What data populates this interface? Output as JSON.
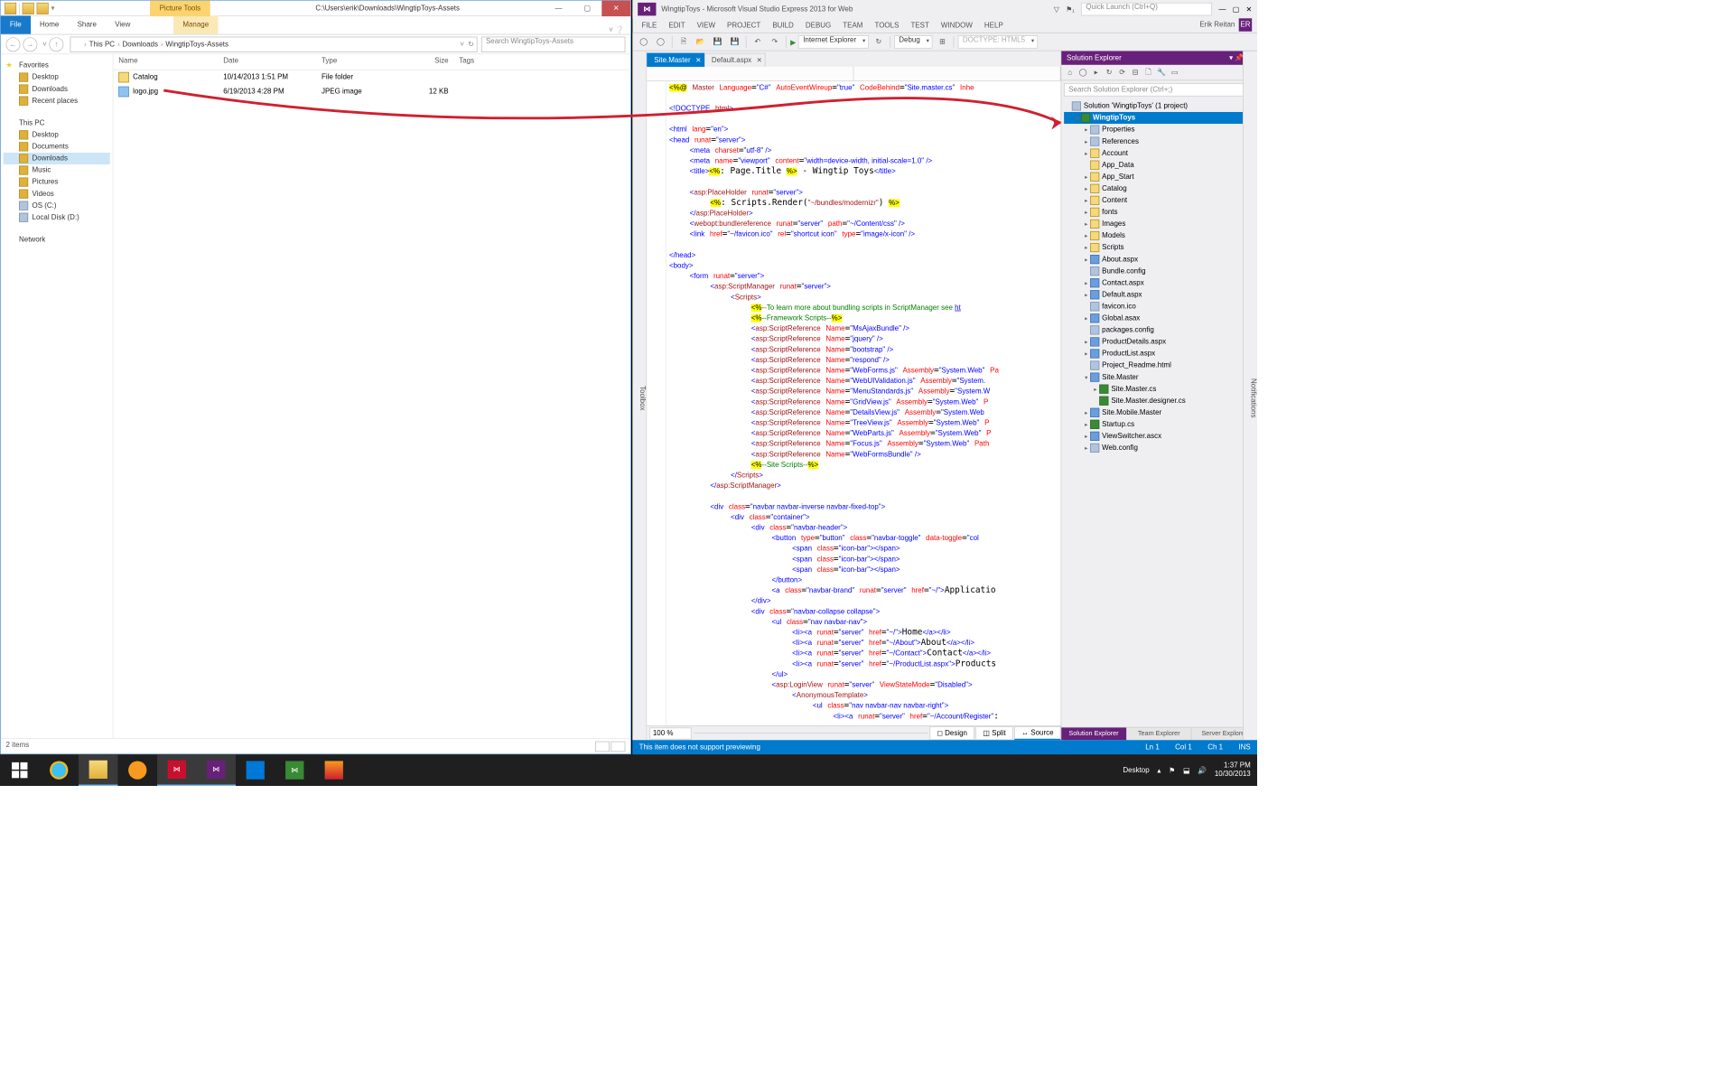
{
  "explorer": {
    "title": "C:\\Users\\erik\\Downloads\\WingtipToys-Assets",
    "context_tab": "Picture Tools",
    "ribbon": {
      "file": "File",
      "home": "Home",
      "share": "Share",
      "view": "View",
      "manage": "Manage"
    },
    "breadcrumbs": [
      "This PC",
      "Downloads",
      "WingtipToys-Assets"
    ],
    "search_placeholder": "Search WingtipToys-Assets",
    "columns": {
      "name": "Name",
      "date": "Date",
      "type": "Type",
      "size": "Size",
      "tags": "Tags"
    },
    "rows": [
      {
        "icon": "folder",
        "name": "Catalog",
        "date": "10/14/2013 1:51 PM",
        "type": "File folder",
        "size": "",
        "tags": ""
      },
      {
        "icon": "image",
        "name": "logo.jpg",
        "date": "6/19/2013 4:28 PM",
        "type": "JPEG image",
        "size": "12 KB",
        "tags": ""
      }
    ],
    "nav": {
      "favorites": {
        "label": "Favorites",
        "items": [
          "Desktop",
          "Downloads",
          "Recent places"
        ]
      },
      "thispc": {
        "label": "This PC",
        "items": [
          {
            "l": "Desktop"
          },
          {
            "l": "Documents"
          },
          {
            "l": "Downloads",
            "sel": true
          },
          {
            "l": "Music"
          },
          {
            "l": "Pictures"
          },
          {
            "l": "Videos"
          },
          {
            "l": "OS (C:)",
            "drv": true
          },
          {
            "l": "Local Disk (D:)",
            "drv": true
          }
        ]
      },
      "network": {
        "label": "Network"
      }
    },
    "status": "2 items"
  },
  "vs": {
    "title": "WingtipToys - Microsoft Visual Studio Express 2013 for Web",
    "user": "Erik Reitan",
    "user_initials": "ER",
    "quick_launch": "Quick Launch (Ctrl+Q)",
    "menus": [
      "FILE",
      "EDIT",
      "VIEW",
      "PROJECT",
      "BUILD",
      "DEBUG",
      "TEAM",
      "TOOLS",
      "TEST",
      "WINDOW",
      "HELP"
    ],
    "toolbar": {
      "browser": "Internet Explorer",
      "config": "Debug",
      "doctype": "DOCTYPE: HTML5"
    },
    "toolbox_label": "Toolbox",
    "notifications_label": "Notifications",
    "editor_tabs": [
      {
        "l": "Site.Master",
        "act": true
      },
      {
        "l": "Default.aspx"
      }
    ],
    "view_tabs": {
      "design": "Design",
      "split": "Split",
      "source": "Source"
    },
    "zoom": "100 %",
    "status": {
      "msg": "This item does not support previewing",
      "ln": "Ln 1",
      "col": "Col 1",
      "ch": "Ch 1",
      "ins": "INS"
    },
    "se": {
      "title": "Solution Explorer",
      "search": "Search Solution Explorer (Ctrl+;)",
      "sol": "Solution 'WingtipToys' (1 project)",
      "proj": "WingtipToys",
      "items": [
        {
          "l": "Properties",
          "i": "cfg",
          "tw": "▸",
          "ind": 2
        },
        {
          "l": "References",
          "i": "cfg",
          "tw": "▸",
          "ind": 2
        },
        {
          "l": "Account",
          "i": "fld",
          "tw": "▸",
          "ind": 2
        },
        {
          "l": "App_Data",
          "i": "fld",
          "tw": "",
          "ind": 2
        },
        {
          "l": "App_Start",
          "i": "fld",
          "tw": "▸",
          "ind": 2
        },
        {
          "l": "Catalog",
          "i": "fld",
          "tw": "▸",
          "ind": 2
        },
        {
          "l": "Content",
          "i": "fld",
          "tw": "▸",
          "ind": 2
        },
        {
          "l": "fonts",
          "i": "fld",
          "tw": "▸",
          "ind": 2
        },
        {
          "l": "Images",
          "i": "fld",
          "tw": "▸",
          "ind": 2
        },
        {
          "l": "Models",
          "i": "fld",
          "tw": "▸",
          "ind": 2
        },
        {
          "l": "Scripts",
          "i": "fld",
          "tw": "▸",
          "ind": 2
        },
        {
          "l": "About.aspx",
          "i": "asp",
          "tw": "▸",
          "ind": 2
        },
        {
          "l": "Bundle.config",
          "i": "cfg",
          "tw": "",
          "ind": 2
        },
        {
          "l": "Contact.aspx",
          "i": "asp",
          "tw": "▸",
          "ind": 2
        },
        {
          "l": "Default.aspx",
          "i": "asp",
          "tw": "▸",
          "ind": 2
        },
        {
          "l": "favicon.ico",
          "i": "cfg",
          "tw": "",
          "ind": 2
        },
        {
          "l": "Global.asax",
          "i": "asp",
          "tw": "▸",
          "ind": 2
        },
        {
          "l": "packages.config",
          "i": "cfg",
          "tw": "",
          "ind": 2
        },
        {
          "l": "ProductDetails.aspx",
          "i": "asp",
          "tw": "▸",
          "ind": 2
        },
        {
          "l": "ProductList.aspx",
          "i": "asp",
          "tw": "▸",
          "ind": 2
        },
        {
          "l": "Project_Readme.html",
          "i": "cfg",
          "tw": "",
          "ind": 2
        },
        {
          "l": "Site.Master",
          "i": "asp",
          "tw": "▾",
          "ind": 2
        },
        {
          "l": "Site.Master.cs",
          "i": "cs",
          "tw": "▸",
          "ind": 3
        },
        {
          "l": "Site.Master.designer.cs",
          "i": "cs",
          "tw": "",
          "ind": 3
        },
        {
          "l": "Site.Mobile.Master",
          "i": "asp",
          "tw": "▸",
          "ind": 2
        },
        {
          "l": "Startup.cs",
          "i": "cs",
          "tw": "▸",
          "ind": 2
        },
        {
          "l": "ViewSwitcher.ascx",
          "i": "asp",
          "tw": "▸",
          "ind": 2
        },
        {
          "l": "Web.config",
          "i": "cfg",
          "tw": "▸",
          "ind": 2
        }
      ],
      "foot": [
        "Solution Explorer",
        "Team Explorer",
        "Server Explorer"
      ]
    }
  },
  "taskbar": {
    "tray": {
      "desktop": "Desktop",
      "time": "1:37 PM",
      "date": "10/30/2013"
    }
  }
}
